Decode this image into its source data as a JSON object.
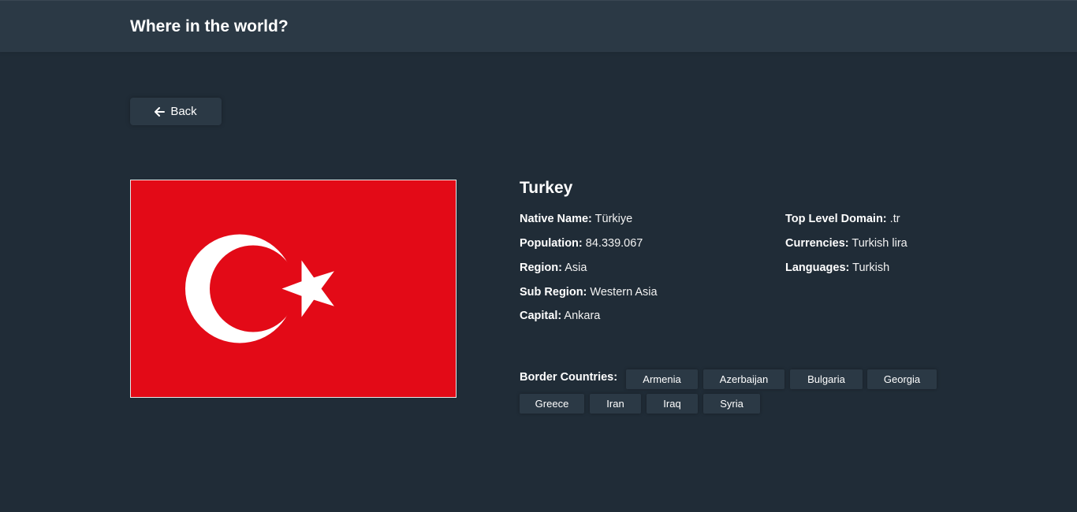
{
  "header": {
    "title": "Where in the world?"
  },
  "back_button": {
    "label": "Back",
    "icon": "arrow-left-icon"
  },
  "country": {
    "name": "Turkey",
    "flag": {
      "icon": "flag-of-turkey",
      "colors": {
        "field": "#e30a17",
        "emblem": "#ffffff"
      }
    },
    "details_left": [
      {
        "label": "Native Name:",
        "value": "Türkiye"
      },
      {
        "label": "Population:",
        "value": "84.339.067"
      },
      {
        "label": "Region:",
        "value": "Asia"
      },
      {
        "label": "Sub Region:",
        "value": "Western Asia"
      },
      {
        "label": "Capital:",
        "value": "Ankara"
      }
    ],
    "details_right": [
      {
        "label": "Top Level Domain:",
        "value": ".tr"
      },
      {
        "label": "Currencies:",
        "value": "Turkish lira"
      },
      {
        "label": "Languages:",
        "value": "Turkish"
      }
    ],
    "border_countries_label": "Border Countries:",
    "border_countries": [
      "Armenia",
      "Azerbaijan",
      "Bulgaria",
      "Georgia",
      "Greece",
      "Iran",
      "Iraq",
      "Syria"
    ]
  },
  "theme": {
    "background": "#202c37",
    "elements": "#2b3945",
    "text": "#ffffff"
  }
}
